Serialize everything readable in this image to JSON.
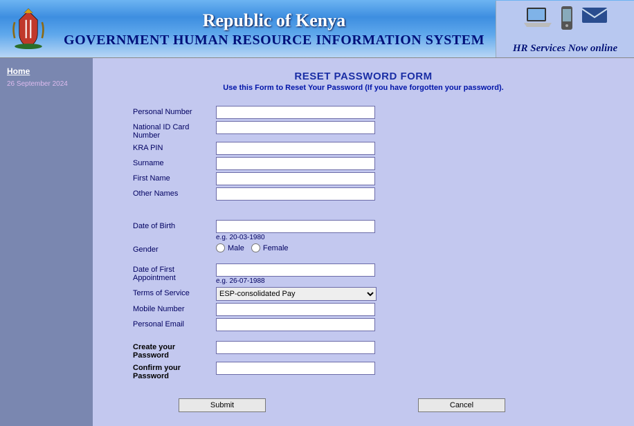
{
  "header": {
    "title1": "Republic of Kenya",
    "title2": "GOVERNMENT HUMAN RESOURCE INFORMATION SYSTEM",
    "slogan": "HR Services Now online"
  },
  "sidebar": {
    "home_label": "Home",
    "date": "26 September 2024"
  },
  "form": {
    "title": "RESET PASSWORD FORM",
    "subtitle": "Use this Form to Reset Your Password (If you have forgotten your password).",
    "labels": {
      "personal_number": "Personal Number",
      "national_id": "National ID Card Number",
      "kra_pin": "KRA PIN",
      "surname": "Surname",
      "first_name": "First Name",
      "other_names": "Other Names",
      "dob": "Date of Birth",
      "gender": "Gender",
      "male": "Male",
      "female": "Female",
      "first_appointment": "Date of First Appointment",
      "terms": "Terms of Service",
      "mobile": "Mobile Number",
      "email": "Personal Email",
      "create_pw": "Create your Password",
      "confirm_pw": "Confirm your Password"
    },
    "hints": {
      "dob": "e.g. 20-03-1980",
      "first_appointment": "e.g. 26-07-1988"
    },
    "terms_selected": "ESP-consolidated Pay",
    "values": {
      "personal_number": "",
      "national_id": "",
      "kra_pin": "",
      "surname": "",
      "first_name": "",
      "other_names": "",
      "dob": "",
      "first_appointment": "",
      "mobile": "",
      "email": "",
      "create_pw": "",
      "confirm_pw": ""
    },
    "buttons": {
      "submit": "Submit",
      "cancel": "Cancel"
    }
  }
}
